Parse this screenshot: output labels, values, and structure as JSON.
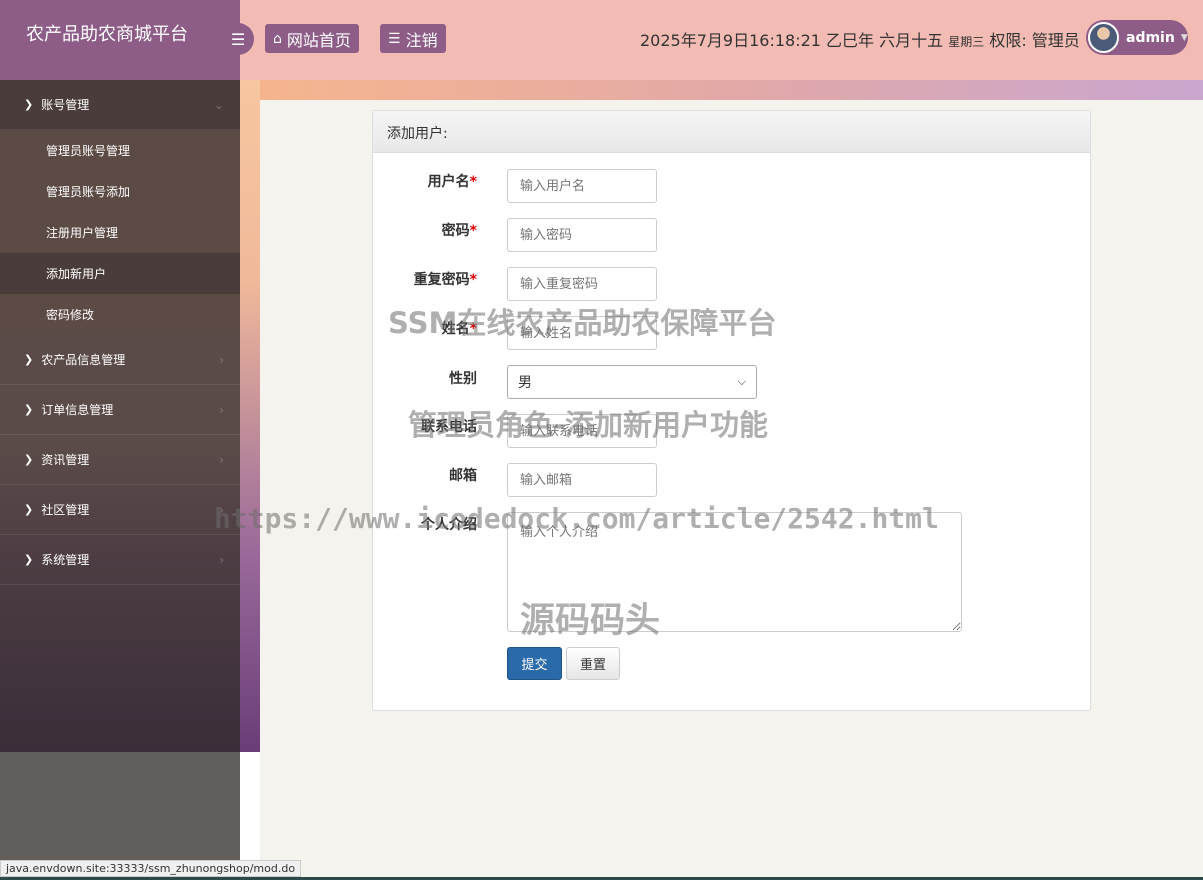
{
  "header": {
    "brand": "农产品助农商城平台",
    "home_label": "网站首页",
    "logout_label": "注销",
    "datetime": "2025年7月9日16:18:21 乙巳年 六月十五",
    "weekday": "星期三",
    "role_label": "权限: 管理员",
    "username": "admin"
  },
  "sidebar": {
    "groups": [
      {
        "label": "账号管理",
        "items": [
          "管理员账号管理",
          "管理员账号添加",
          "注册用户管理",
          "添加新用户",
          "密码修改"
        ]
      },
      {
        "label": "农产品信息管理"
      },
      {
        "label": "订单信息管理"
      },
      {
        "label": "资讯管理"
      },
      {
        "label": "社区管理"
      },
      {
        "label": "系统管理"
      }
    ]
  },
  "panel": {
    "title": "添加用户:",
    "fields": {
      "username": {
        "label": "用户名",
        "placeholder": "输入用户名"
      },
      "password": {
        "label": "密码",
        "placeholder": "输入密码"
      },
      "repeat": {
        "label": "重复密码",
        "placeholder": "输入重复密码"
      },
      "name": {
        "label": "姓名",
        "placeholder": "输入姓名"
      },
      "gender": {
        "label": "性别",
        "value": "男"
      },
      "phone": {
        "label": "联系电话",
        "placeholder": "输入联系电话"
      },
      "email": {
        "label": "邮箱",
        "placeholder": "输入邮箱"
      },
      "intro": {
        "label": "个人介绍",
        "placeholder": "输入个人介绍"
      }
    },
    "submit_label": "提交",
    "reset_label": "重置"
  },
  "watermarks": {
    "line1": "SSM在线农产品助农保障平台",
    "line2": "管理员角色-添加新用户功能",
    "line3": "https://www.icodedock.com/article/2542.html",
    "line4": "源码码头"
  },
  "statusbar": {
    "url": "java.envdown.site:33333/ssm_zhunongshop/mod.do"
  }
}
